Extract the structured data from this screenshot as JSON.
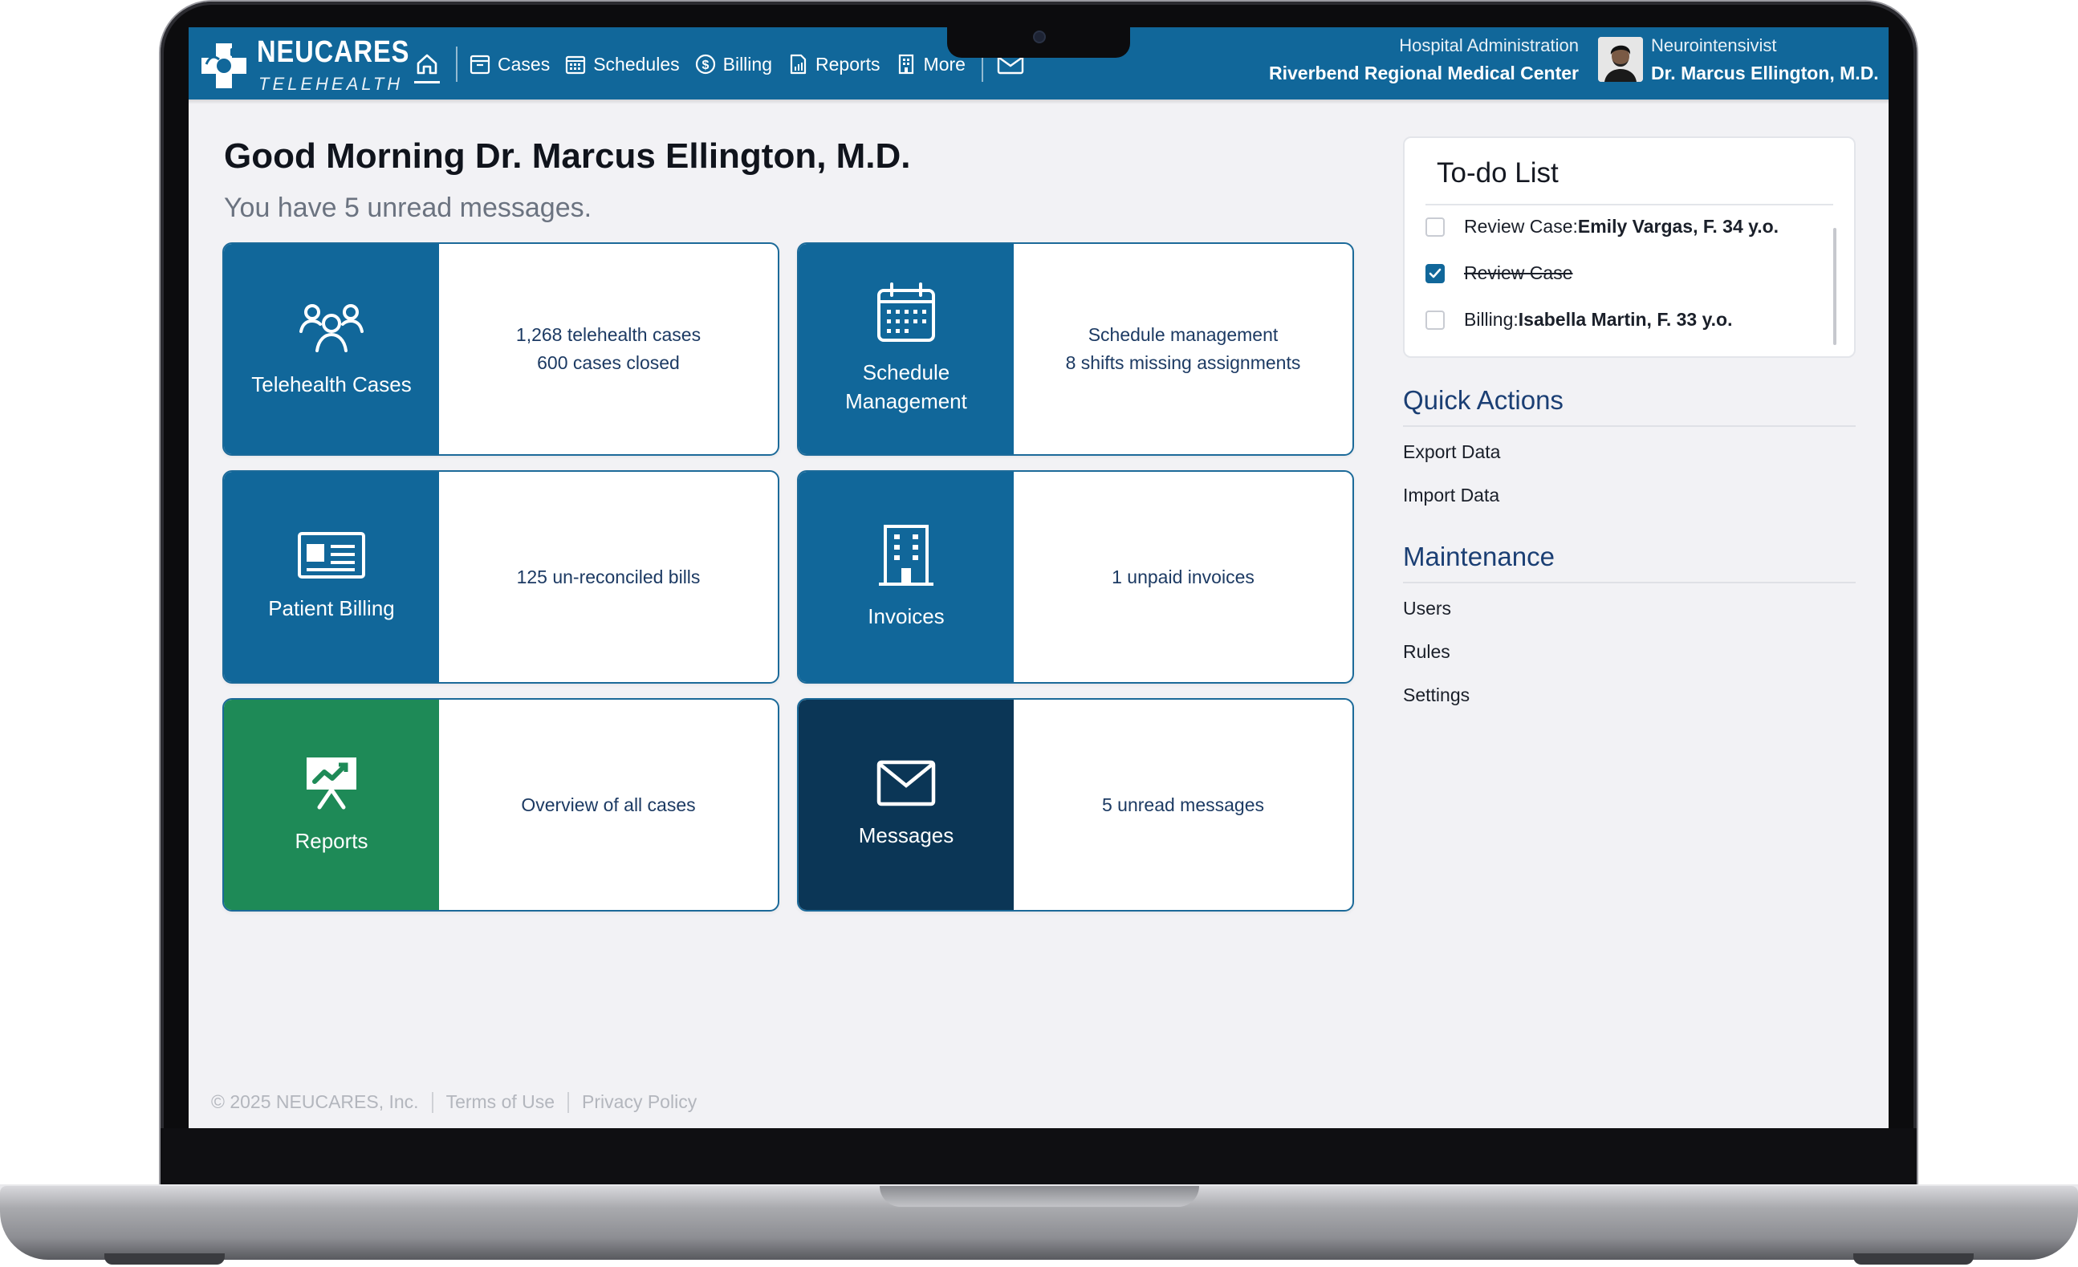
{
  "brand": {
    "name": "NEUCARES",
    "sub": "TELEHEALTH"
  },
  "nav": {
    "items": [
      {
        "label": "Cases",
        "icon": "cases-icon"
      },
      {
        "label": "Schedules",
        "icon": "calendar-icon"
      },
      {
        "label": "Billing",
        "icon": "dollar-icon"
      },
      {
        "label": "Reports",
        "icon": "report-icon"
      },
      {
        "label": "More",
        "icon": "building-icon"
      }
    ]
  },
  "header": {
    "org_role": "Hospital Administration",
    "org_name": "Riverbend Regional Medical Center",
    "user_role": "Neurointensivist",
    "user_name": "Dr. Marcus Ellington, M.D."
  },
  "greeting": {
    "title": "Good Morning Dr. Marcus Ellington, M.D.",
    "subtitle": "You have 5 unread messages."
  },
  "cards": [
    {
      "title": "Telehealth Cases",
      "lines": [
        "1,268 telehealth cases",
        "600 cases closed"
      ],
      "color": "#11679a"
    },
    {
      "title": "Schedule Management",
      "title_lines": [
        "Schedule",
        "Management"
      ],
      "lines": [
        "Schedule management",
        "8 shifts missing assignments"
      ],
      "color": "#11679a"
    },
    {
      "title": "Patient Billing",
      "lines": [
        "125 un-reconciled bills"
      ],
      "color": "#11679a"
    },
    {
      "title": "Invoices",
      "lines": [
        "1 unpaid invoices"
      ],
      "color": "#11679a"
    },
    {
      "title": "Reports",
      "lines": [
        "Overview of all cases"
      ],
      "color": "#1e8a57"
    },
    {
      "title": "Messages",
      "lines": [
        "5 unread messages"
      ],
      "color": "#0b3656"
    }
  ],
  "todo": {
    "title": "To-do List",
    "items": [
      {
        "prefix": "Review Case: ",
        "bold": "Emily Vargas, F. 34 y.o.",
        "checked": false
      },
      {
        "prefix": "Review Case",
        "bold": "",
        "checked": true
      },
      {
        "prefix": "Billing: ",
        "bold": "Isabella Martin, F. 33 y.o.",
        "checked": false
      }
    ]
  },
  "quick_actions": {
    "title": "Quick Actions",
    "items": [
      "Export Data",
      "Import Data"
    ]
  },
  "maintenance": {
    "title": "Maintenance",
    "items": [
      "Users",
      "Rules",
      "Settings"
    ]
  },
  "footer": {
    "copyright": "© 2025 NEUCARES, Inc.",
    "terms": "Terms of Use",
    "privacy": "Privacy Policy"
  }
}
